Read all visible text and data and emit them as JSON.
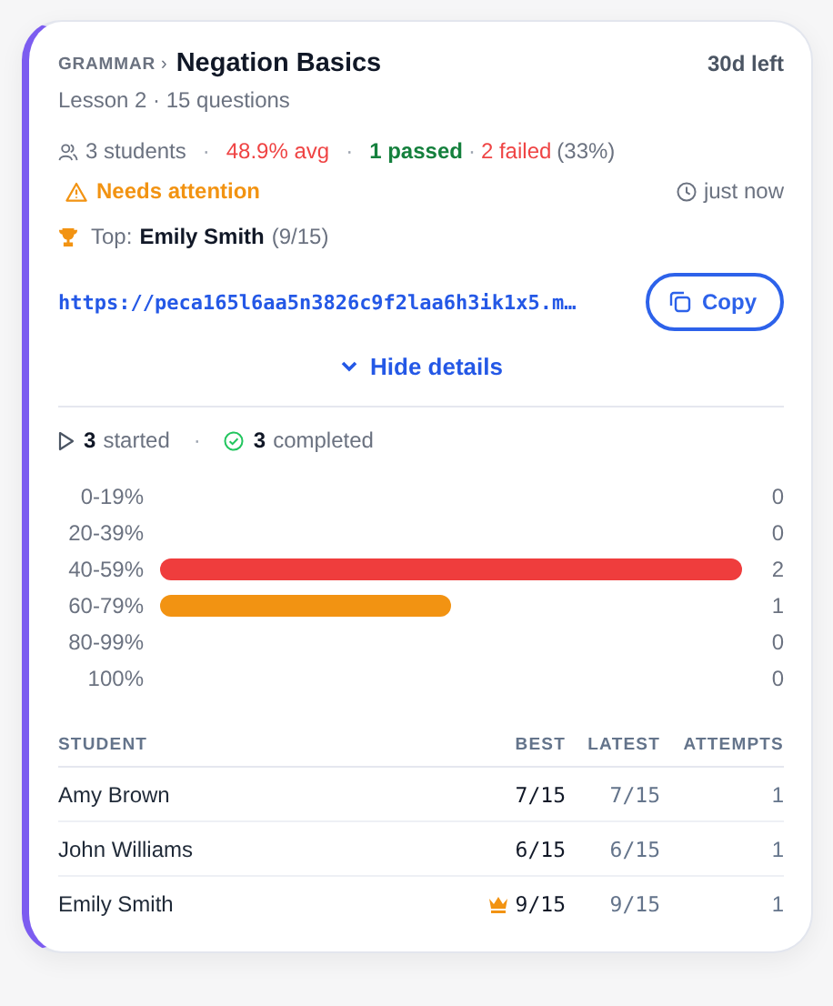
{
  "header": {
    "category": "GRAMMAR",
    "separator": "›",
    "title": "Negation Basics",
    "subtitle": "Lesson 2 · 15 questions",
    "time_left": "30d left"
  },
  "stats": {
    "students": "3 students",
    "separator_1": "·",
    "average": "48.9% avg",
    "separator_2": "·",
    "passed": "1 passed",
    "separator_3": "·",
    "failed": "2 failed",
    "failed_share": "(33%)"
  },
  "alert": {
    "text": "Needs attention",
    "updated": "just now"
  },
  "top": {
    "label": "Top:",
    "name": "Emily Smith",
    "score": "(9/15)"
  },
  "link": {
    "url": "https://peca165l6aa5n3826c9f2laa6h3ik1x5.m…",
    "button": "Copy"
  },
  "toggle": {
    "label": "Hide details",
    "expanded": true
  },
  "progress": {
    "started_count": "3",
    "started": "started",
    "separator": "·",
    "completed_count": "3",
    "completed": "completed"
  },
  "distribution": [
    {
      "label": "0-19%",
      "count": "0"
    },
    {
      "label": "20-39%",
      "count": "0"
    },
    {
      "label": "40-59%",
      "count": "2",
      "color": "#ef3d3d"
    },
    {
      "label": "60-79%",
      "count": "1",
      "color": "#f29312"
    },
    {
      "label": "80-99%",
      "count": "0"
    },
    {
      "label": "100%",
      "count": "0"
    }
  ],
  "table": {
    "columns": [
      "STUDENT",
      "BEST",
      "LATEST",
      "ATTEMPTS"
    ],
    "rows": [
      {
        "student": "Amy Brown",
        "best": "7/15",
        "latest": "7/15",
        "attempts": "1",
        "top": false
      },
      {
        "student": "John Williams",
        "best": "6/15",
        "latest": "6/15",
        "attempts": "1",
        "top": false
      },
      {
        "student": "Emily Smith",
        "best": "9/15",
        "latest": "9/15",
        "attempts": "1",
        "top": true
      }
    ]
  }
}
